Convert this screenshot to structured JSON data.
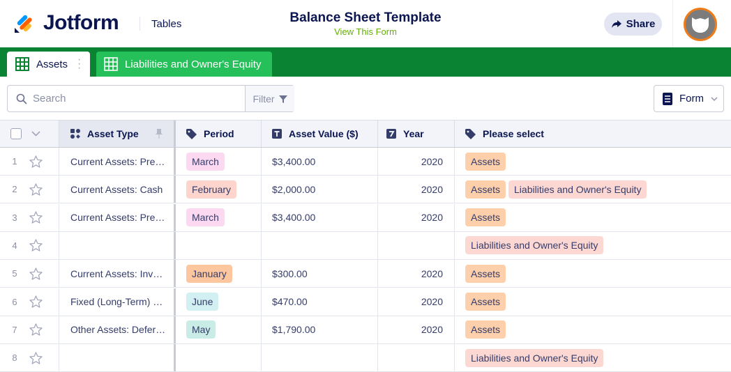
{
  "header": {
    "brand": "Jotform",
    "section": "Tables",
    "title": "Balance Sheet Template",
    "subtitle": "View This Form",
    "share_label": "Share"
  },
  "tabs": [
    {
      "label": "Assets",
      "active": true
    },
    {
      "label": "Liabilities and Owner's Equity",
      "active": false
    }
  ],
  "toolbar": {
    "search_placeholder": "Search",
    "filter_label": "Filter",
    "form_label": "Form"
  },
  "columns": [
    "Asset Type",
    "Period",
    "Asset Value ($)",
    "Year",
    "Please select"
  ],
  "rows": [
    {
      "n": "1",
      "type": "Current Assets: Pre…",
      "period": "March",
      "value": "$3,400.00",
      "year": "2020",
      "select": [
        "Assets"
      ]
    },
    {
      "n": "2",
      "type": "Current Assets: Cash",
      "period": "February",
      "value": "$2,000.00",
      "year": "2020",
      "select": [
        "Assets",
        "Liabilities and Owner's Equity"
      ]
    },
    {
      "n": "3",
      "type": "Current Assets: Pre…",
      "period": "March",
      "value": "$3,400.00",
      "year": "2020",
      "select": [
        "Assets"
      ]
    },
    {
      "n": "4",
      "type": "",
      "period": "",
      "value": "",
      "year": "",
      "select": [
        "Liabilities and Owner's Equity"
      ]
    },
    {
      "n": "5",
      "type": "Current Assets: Inv…",
      "period": "January",
      "value": "$300.00",
      "year": "2020",
      "select": [
        "Assets"
      ]
    },
    {
      "n": "6",
      "type": "Fixed (Long-Term) …",
      "period": "June",
      "value": "$470.00",
      "year": "2020",
      "select": [
        "Assets"
      ]
    },
    {
      "n": "7",
      "type": "Other Assets: Defer…",
      "period": "May",
      "value": "$1,790.00",
      "year": "2020",
      "select": [
        "Assets"
      ]
    },
    {
      "n": "8",
      "type": "",
      "period": "",
      "value": "",
      "year": "",
      "select": [
        "Liabilities and Owner's Equity"
      ]
    }
  ],
  "colors": {
    "green": "#0a8433",
    "tab_green": "#26c05a",
    "March": "#fcd9f0",
    "February": "#fdd5cc",
    "January": "#fcc79f",
    "June": "#d2eff2",
    "May": "#c9ece6",
    "Assets": "#fdcfab",
    "Liabilities and Owner's Equity": "#fdd8d2"
  }
}
